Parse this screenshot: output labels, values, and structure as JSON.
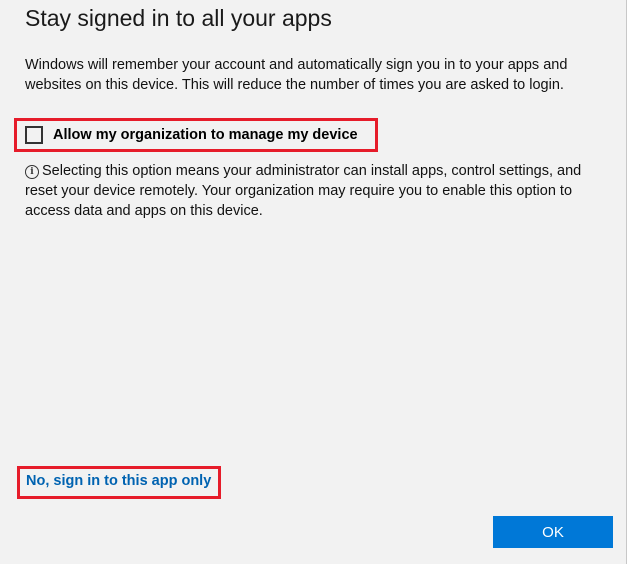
{
  "dialog": {
    "title": "Stay signed in to all your apps",
    "description": "Windows will remember your account and automatically sign you in to your apps and websites on this device. This will reduce the number of times you are asked to login.",
    "checkbox": {
      "label": "Allow my organization to manage my device",
      "checked": false
    },
    "info": {
      "icon": "info-icon",
      "icon_glyph": "i",
      "text": "Selecting this option means your administrator can install apps, control settings, and reset your device remotely. Your organization may require you to enable this option to access data and apps on this device."
    },
    "skip_link": "No, sign in to this app only",
    "ok_button": "OK"
  },
  "colors": {
    "dialog_background": "#f2f2f2",
    "highlight_border": "#e61c2a",
    "link": "#0063b1",
    "primary_button": "#0078d7"
  }
}
